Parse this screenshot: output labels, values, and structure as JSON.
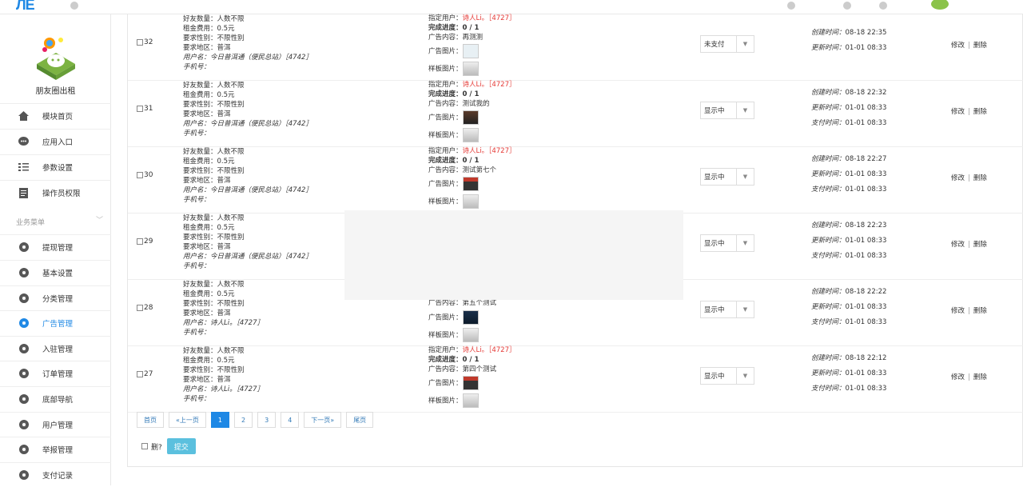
{
  "topbar": {
    "logo": "ЛЕ"
  },
  "sidebar": {
    "brand_name": "朋友圈出租",
    "items": [
      {
        "label": "模块首页",
        "icon": "home-icon"
      },
      {
        "label": "应用入口",
        "icon": "chat-icon"
      },
      {
        "label": "参数设置",
        "icon": "list-icon"
      },
      {
        "label": "操作员权限",
        "icon": "doc-icon"
      }
    ],
    "section": "业务菜单",
    "biz_items": [
      {
        "label": "提现管理"
      },
      {
        "label": "基本设置"
      },
      {
        "label": "分类管理"
      },
      {
        "label": "广告管理"
      },
      {
        "label": "入驻管理"
      },
      {
        "label": "订单管理"
      },
      {
        "label": "底部导航"
      },
      {
        "label": "用户管理"
      },
      {
        "label": "举报管理"
      },
      {
        "label": "支付记录"
      }
    ]
  },
  "labels": {
    "friends": "好友数量：",
    "fee": "租金费用：",
    "gender": "要求性别：",
    "region": "要求地区：",
    "username": "用户名：",
    "phone": "手机号：",
    "target": "指定用户：",
    "progress": "完成进度：",
    "content": "广告内容：",
    "image": "广告图片：",
    "sample": "样板图片：",
    "created": "创建时间：",
    "updated": "更新时间：",
    "paid": "支付时间：",
    "edit": "修改",
    "delete": "删除",
    "sep": "|"
  },
  "rows": [
    {
      "id": "32",
      "friends": "人数不限",
      "fee": "0.5元",
      "gender": "不限性别",
      "region": "普洱",
      "username": "今日普洱通（便民总站）［4742］",
      "phone": "",
      "target": "诗人Li。［4727］",
      "progress": "0 / 1",
      "content": "再测测",
      "status": "未支付",
      "created": "08-18 22:35",
      "updated": "01-01 08:33",
      "paid": ""
    },
    {
      "id": "31",
      "friends": "人数不限",
      "fee": "0.5元",
      "gender": "不限性别",
      "region": "普洱",
      "username": "今日普洱通（便民总站）［4742］",
      "phone": "",
      "target": "诗人Li。［4727］",
      "progress": "0 / 1",
      "content": "测试我的",
      "status": "显示中",
      "created": "08-18 22:32",
      "updated": "01-01 08:33",
      "paid": "01-01 08:33"
    },
    {
      "id": "30",
      "friends": "人数不限",
      "fee": "0.5元",
      "gender": "不限性别",
      "region": "普洱",
      "username": "今日普洱通（便民总站）［4742］",
      "phone": "",
      "target": "诗人Li。［4727］",
      "progress": "0 / 1",
      "content": "测试第七个",
      "status": "显示中",
      "created": "08-18 22:27",
      "updated": "01-01 08:33",
      "paid": "01-01 08:33"
    },
    {
      "id": "29",
      "friends": "人数不限",
      "fee": "0.5元",
      "gender": "不限性别",
      "region": "普洱",
      "username": "今日普洱通（便民总站）［4742］",
      "phone": "",
      "target": "",
      "progress": "",
      "content": "",
      "status": "显示中",
      "created": "08-18 22:23",
      "updated": "01-01 08:33",
      "paid": "01-01 08:33"
    },
    {
      "id": "28",
      "friends": "人数不限",
      "fee": "0.5元",
      "gender": "不限性别",
      "region": "普洱",
      "username": "诗人Li。［4727］",
      "phone": "",
      "target": "",
      "progress": "",
      "content": "第五个测试",
      "status": "显示中",
      "created": "08-18 22:22",
      "updated": "01-01 08:33",
      "paid": "01-01 08:33"
    },
    {
      "id": "27",
      "friends": "人数不限",
      "fee": "0.5元",
      "gender": "不限性别",
      "region": "普洱",
      "username": "诗人Li。［4727］",
      "phone": "",
      "target": "诗人Li。［4727］",
      "progress": "0 / 1",
      "content": "第四个测试",
      "status": "显示中",
      "created": "08-18 22:12",
      "updated": "01-01 08:33",
      "paid": "01-01 08:33"
    }
  ],
  "pager": {
    "first": "首页",
    "prev": "«上一页",
    "pages": [
      "1",
      "2",
      "3",
      "4"
    ],
    "next": "下一页»",
    "last": "尾页",
    "current": "1"
  },
  "bottom": {
    "delete_label": "删?",
    "submit": "提交"
  }
}
